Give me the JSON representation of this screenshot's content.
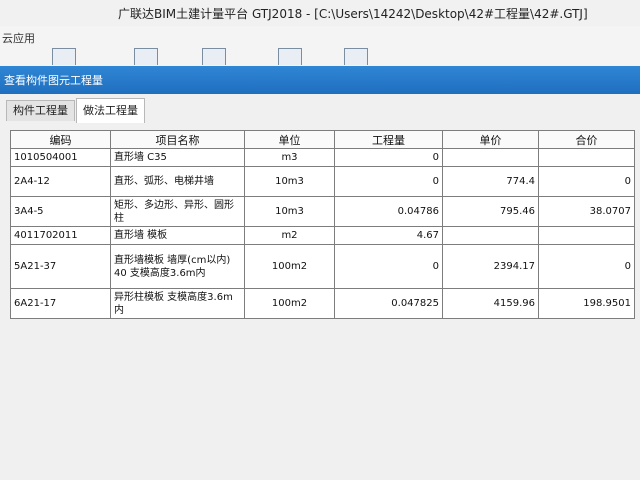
{
  "window": {
    "title": "广联达BIM土建计量平台 GTJ2018 - [C:\\Users\\14242\\Desktop\\42#工程量\\42#.GTJ]"
  },
  "ribbon": {
    "menu_label": "云应用"
  },
  "panel": {
    "title": "查看构件图元工程量"
  },
  "tabs": [
    {
      "label": "构件工程量"
    },
    {
      "label": "做法工程量"
    }
  ],
  "table": {
    "headers": [
      "编码",
      "项目名称",
      "单位",
      "工程量",
      "单价",
      "合价"
    ],
    "rows": [
      {
        "num": "1",
        "code": "010504001",
        "name": "直形墙 C35",
        "unit": "m3",
        "qty": "0",
        "price": "",
        "total": ""
      },
      {
        "num": "2",
        "code": "A4-12",
        "name": "直形、弧形、电梯井墙",
        "unit": "10m3",
        "qty": "0",
        "price": "774.4",
        "total": "0"
      },
      {
        "num": "3",
        "code": "A4-5",
        "name": "矩形、多边形、异形、圆形柱",
        "unit": "10m3",
        "qty": "0.04786",
        "price": "795.46",
        "total": "38.0707"
      },
      {
        "num": "4",
        "code": "011702011",
        "name": "直形墙 模板",
        "unit": "m2",
        "qty": "4.67",
        "price": "",
        "total": ""
      },
      {
        "num": "5",
        "code": "A21-37",
        "name": "直形墙模板 墙厚(cm以内) 40 支模高度3.6m内",
        "unit": "100m2",
        "qty": "0",
        "price": "2394.17",
        "total": "0"
      },
      {
        "num": "6",
        "code": "A21-17",
        "name": "异形柱模板 支模高度3.6m内",
        "unit": "100m2",
        "qty": "0.047825",
        "price": "4159.96",
        "total": "198.9501"
      }
    ]
  }
}
